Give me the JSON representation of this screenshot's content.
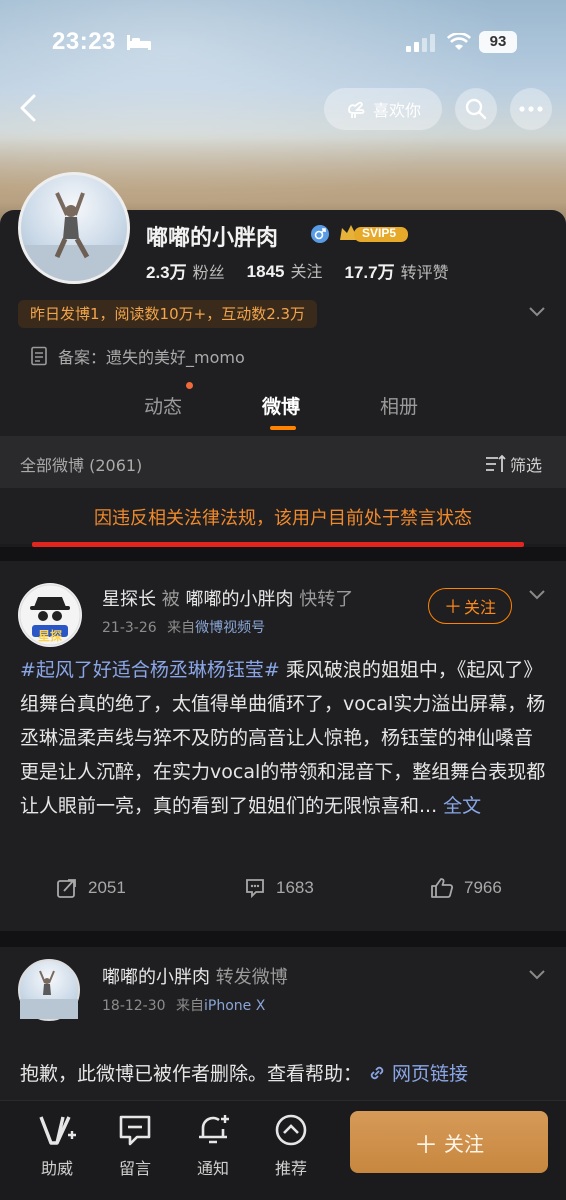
{
  "status_bar": {
    "time": "23:23",
    "battery": "93"
  },
  "header": {
    "like_label": "喜欢你"
  },
  "profile": {
    "name": "嘟嘟的小胖肉",
    "svip": "SVIP5",
    "fans_value": "2.3万",
    "fans_label": "粉丝",
    "follow_value": "1845",
    "follow_label": "关注",
    "repost_value": "17.7万",
    "repost_label": "转评赞",
    "activity": "昨日发博1，阅读数10万+，互动数2.3万",
    "record": "备案：遗失的美好_momo"
  },
  "tabs": [
    {
      "label": "动态"
    },
    {
      "label": "微博"
    },
    {
      "label": "相册"
    }
  ],
  "filter": {
    "all_label": "全部微博 (2061)",
    "filter_label": "筛选"
  },
  "banned_notice": "因违反相关法律法规，该用户目前处于禁言状态",
  "post1": {
    "author": "星探长",
    "by_text": "被",
    "source_user": "嘟嘟的小胖肉",
    "action_text": "快转了",
    "date": "21-3-26",
    "from_label": "来自",
    "client": "微博视频号",
    "follow_label": "关注",
    "topic": "#起风了好适合杨丞琳杨钰莹#",
    "text": " 乘风破浪的姐姐中，《起风了》组舞台真的绝了，太值得单曲循环了，vocal实力溢出屏幕，杨丞琳温柔声线与猝不及防的高音让人惊艳，杨钰莹的神仙嗓音更是让人沉醉，在实力vocal的带领和混音下，整组舞台表现都让人眼前一亮，真的看到了姐姐们的无限惊喜和... ",
    "more": "全文",
    "reposts": "2051",
    "comments": "1683",
    "likes": "7966",
    "avatar_text": "星探"
  },
  "post2": {
    "author": "嘟嘟的小胖肉",
    "action_text": "转发微博",
    "date": "18-12-30",
    "from_label": "来自",
    "client": "iPhone X",
    "deleted_text": "抱歉，此微博已被作者删除。查看帮助：",
    "link_text": "网页链接"
  },
  "bottom_nav": {
    "items": [
      {
        "label": "助威"
      },
      {
        "label": "留言"
      },
      {
        "label": "通知"
      },
      {
        "label": "推荐"
      }
    ],
    "follow_label": "关注"
  },
  "colors": {
    "accent": "#ff8200",
    "banned": "#f08a2c",
    "link": "#8aa6e6",
    "red_line": "#e2261f"
  }
}
